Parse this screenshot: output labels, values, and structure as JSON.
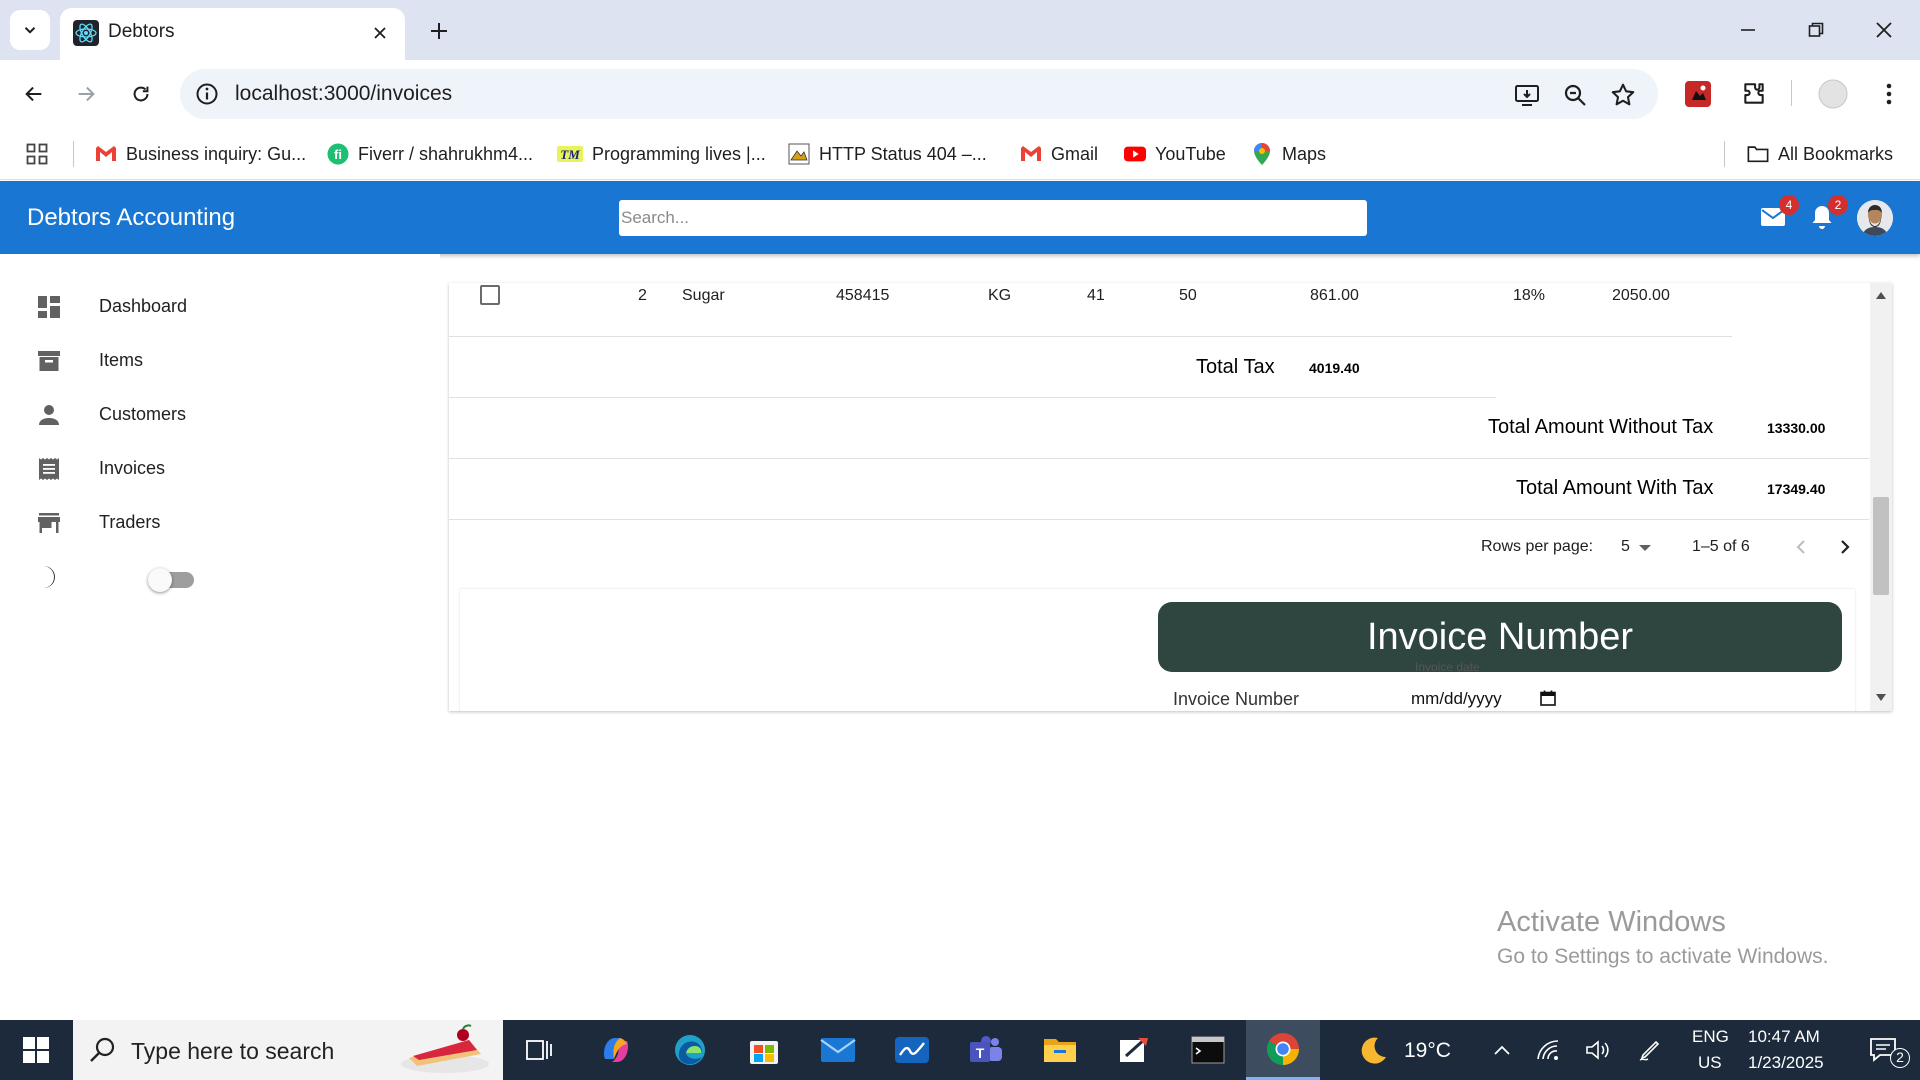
{
  "browser": {
    "tab_title": "Debtors",
    "url": "localhost:3000/invoices",
    "bookmarks": [
      "Business inquiry: Gu...",
      "Fiverr / shahrukhm4...",
      "Programming lives |...",
      "HTTP Status 404 –...",
      "Gmail",
      "YouTube",
      "Maps"
    ],
    "all_bookmarks": "All Bookmarks"
  },
  "app": {
    "title": "Debtors Accounting",
    "search_placeholder": "Search...",
    "mail_count": "4",
    "notification_count": "2",
    "accent": "#1976d2"
  },
  "sidebar": {
    "items": [
      {
        "label": "Dashboard",
        "icon": "dashboard-icon"
      },
      {
        "label": "Items",
        "icon": "archive-icon"
      },
      {
        "label": "Customers",
        "icon": "person-icon"
      },
      {
        "label": "Invoices",
        "icon": "receipt-icon"
      },
      {
        "label": "Traders",
        "icon": "store-icon"
      }
    ],
    "dark_mode_on": false
  },
  "table": {
    "row": {
      "serial": "2",
      "item": "Sugar",
      "code": "458415",
      "unit": "KG",
      "quantity": "41",
      "rate": "50",
      "tax_amount": "861.00",
      "tax_rate": "18%",
      "amount": "2050.00"
    },
    "total_tax_label": "Total Tax",
    "total_tax_value": "4019.40",
    "without_tax_label": "Total Amount Without Tax",
    "without_tax_value": "13330.00",
    "with_tax_label": "Total Amount With Tax",
    "with_tax_value": "17349.40",
    "rows_per_page_label": "Rows per page:",
    "rows_per_page_value": "5",
    "page_range": "1–5 of 6"
  },
  "form": {
    "banner": "Invoice Number",
    "invoice_number_label": "Invoice Number",
    "invoice_date_label": "Invoice date",
    "date_placeholder": "mm/dd/yyyy",
    "banner_color": "#2f4640"
  },
  "watermark": {
    "line1": "Activate Windows",
    "line2": "Go to Settings to activate Windows."
  },
  "taskbar": {
    "search_placeholder": "Type here to search",
    "weather": "19°C",
    "lang_top": "ENG",
    "lang_bottom": "US",
    "time": "10:47 AM",
    "date": "1/23/2025",
    "notifications": "2"
  }
}
